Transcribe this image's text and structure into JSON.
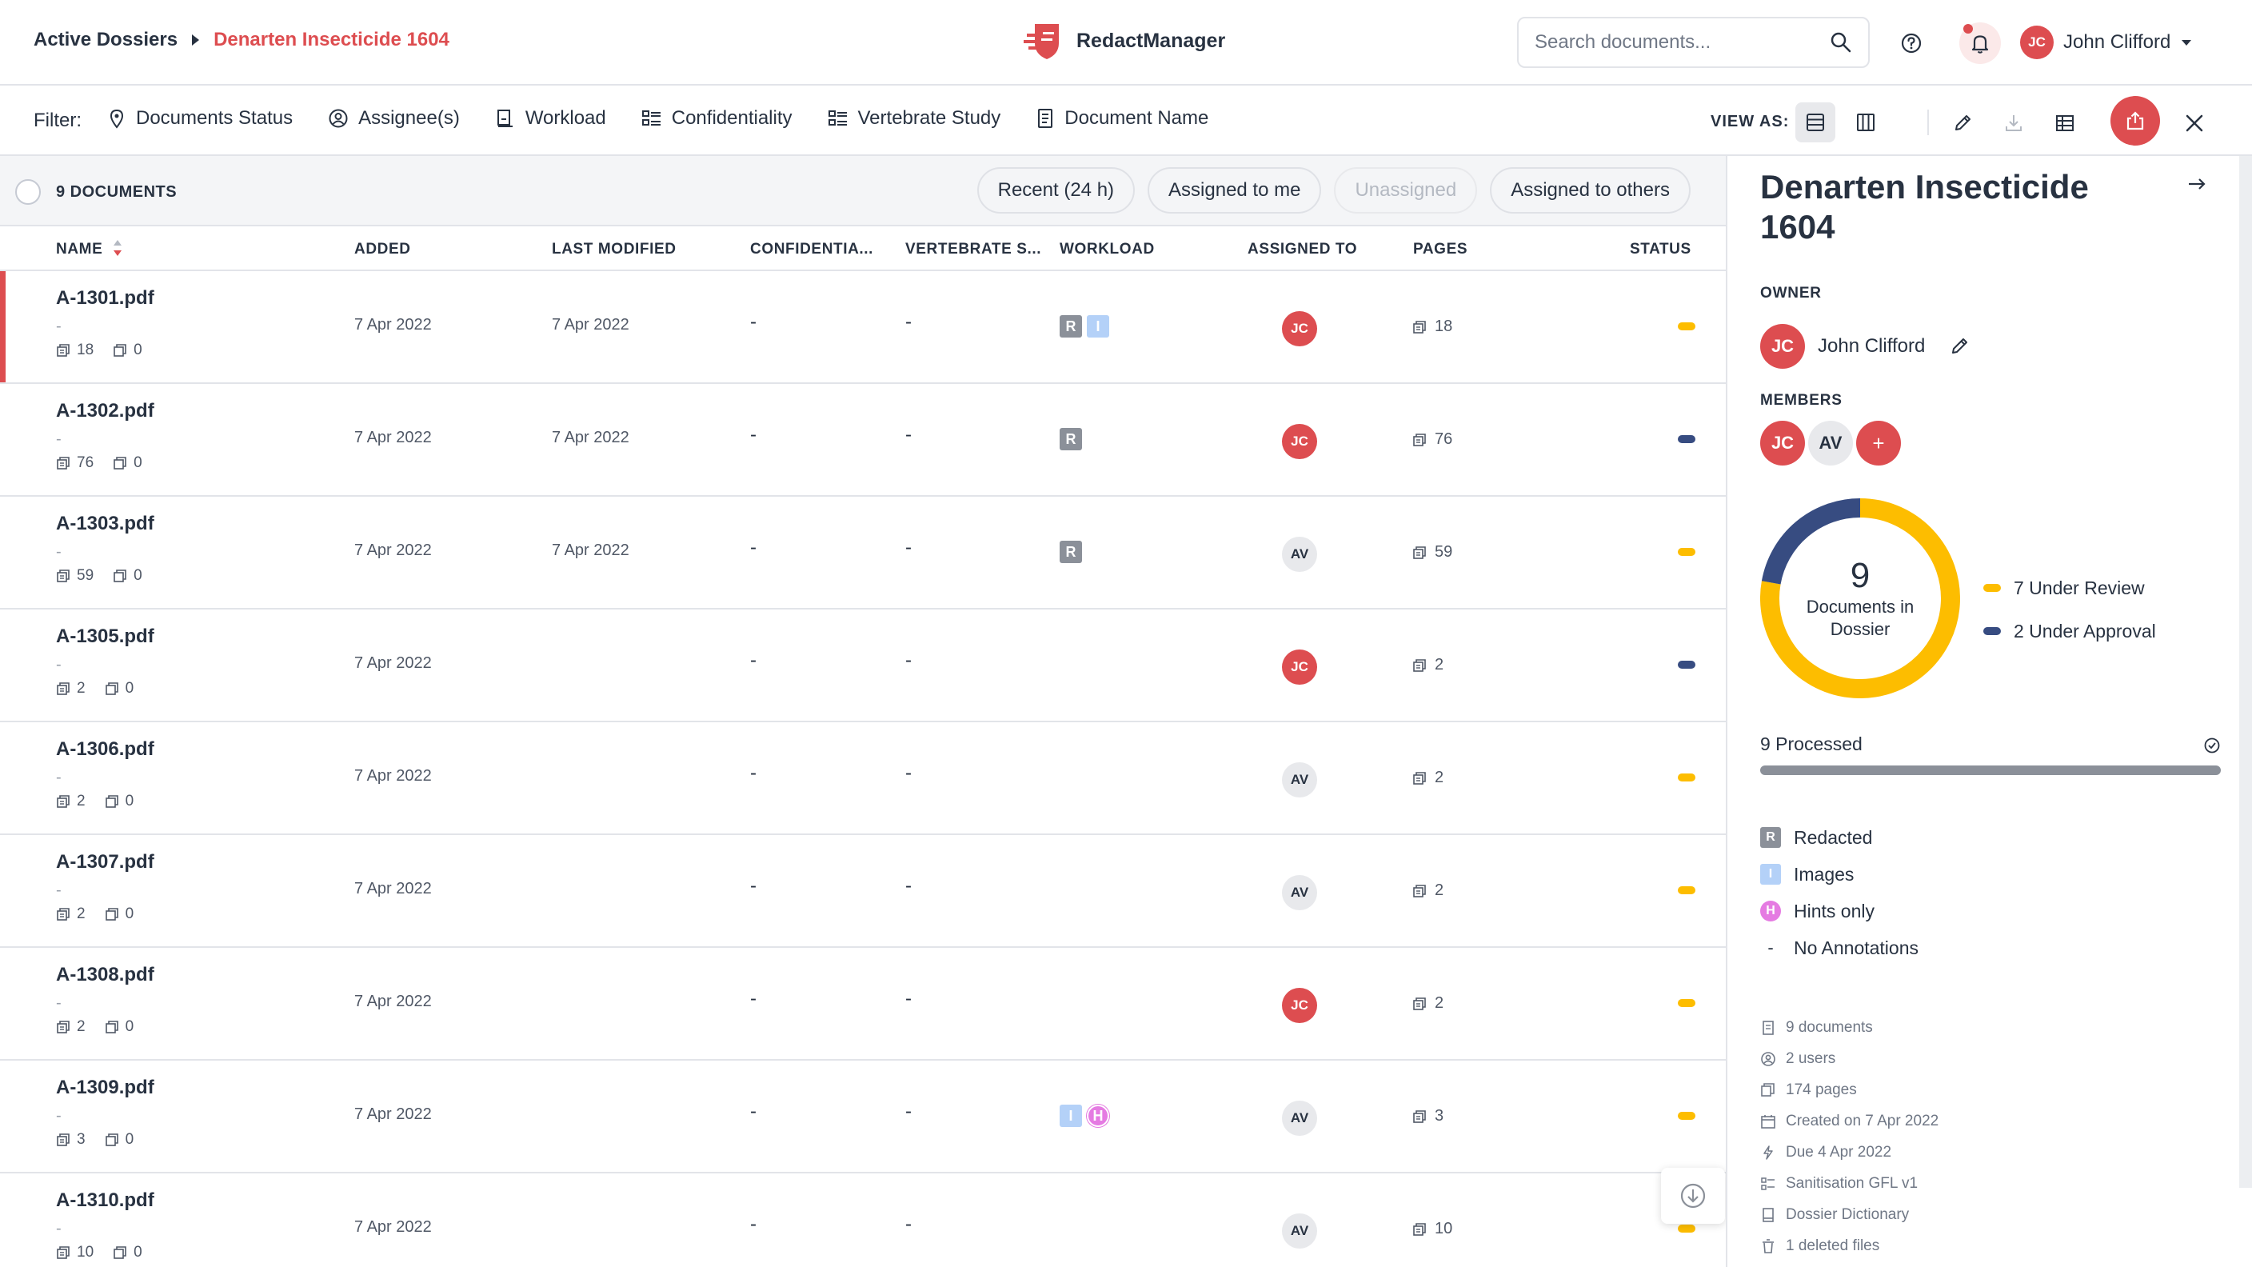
{
  "header": {
    "breadcrumb_root": "Active Dossiers",
    "breadcrumb_current": "Denarten Insecticide 1604",
    "app_name": "RedactManager",
    "search_placeholder": "Search documents...",
    "user_initials": "JC",
    "user_name": "John Clifford"
  },
  "filters": {
    "label": "Filter:",
    "items": [
      {
        "label": "Documents Status",
        "icon": "pin-icon"
      },
      {
        "label": "Assignee(s)",
        "icon": "user-circle-icon"
      },
      {
        "label": "Workload",
        "icon": "workload-icon"
      },
      {
        "label": "Confidentiality",
        "icon": "list-icon"
      },
      {
        "label": "Vertebrate Study",
        "icon": "list-icon"
      },
      {
        "label": "Document Name",
        "icon": "document-icon"
      }
    ],
    "view_as_label": "VIEW AS:"
  },
  "list": {
    "count_label": "9 DOCUMENTS",
    "quick_filters": [
      {
        "label": "Recent (24 h)",
        "disabled": false
      },
      {
        "label": "Assigned to me",
        "disabled": false
      },
      {
        "label": "Unassigned",
        "disabled": true
      },
      {
        "label": "Assigned to others",
        "disabled": false
      }
    ],
    "columns": [
      "NAME",
      "ADDED",
      "LAST MODIFIED",
      "CONFIDENTIA...",
      "VERTEBRATE S...",
      "WORKLOAD",
      "ASSIGNED TO",
      "PAGES",
      "STATUS"
    ],
    "rows": [
      {
        "name": "A-1301.pdf",
        "sub": "-",
        "pages_meta": "18",
        "excluded": "0",
        "added": "7 Apr 2022",
        "modified": "7 Apr 2022",
        "conf": "-",
        "vert": "-",
        "workload": [
          "R",
          "I"
        ],
        "assignee": "JC",
        "pages": "18",
        "status": "under-review",
        "selected": true
      },
      {
        "name": "A-1302.pdf",
        "sub": "-",
        "pages_meta": "76",
        "excluded": "0",
        "added": "7 Apr 2022",
        "modified": "7 Apr 2022",
        "conf": "-",
        "vert": "-",
        "workload": [
          "R"
        ],
        "assignee": "JC",
        "pages": "76",
        "status": "under-approval",
        "selected": false
      },
      {
        "name": "A-1303.pdf",
        "sub": "-",
        "pages_meta": "59",
        "excluded": "0",
        "added": "7 Apr 2022",
        "modified": "7 Apr 2022",
        "conf": "-",
        "vert": "-",
        "workload": [
          "R"
        ],
        "assignee": "AV",
        "pages": "59",
        "status": "under-review",
        "selected": false
      },
      {
        "name": "A-1305.pdf",
        "sub": "-",
        "pages_meta": "2",
        "excluded": "0",
        "added": "7 Apr 2022",
        "modified": "",
        "conf": "-",
        "vert": "-",
        "workload": [],
        "assignee": "JC",
        "pages": "2",
        "status": "under-approval",
        "selected": false
      },
      {
        "name": "A-1306.pdf",
        "sub": "-",
        "pages_meta": "2",
        "excluded": "0",
        "added": "7 Apr 2022",
        "modified": "",
        "conf": "-",
        "vert": "-",
        "workload": [],
        "assignee": "AV",
        "pages": "2",
        "status": "under-review",
        "selected": false
      },
      {
        "name": "A-1307.pdf",
        "sub": "-",
        "pages_meta": "2",
        "excluded": "0",
        "added": "7 Apr 2022",
        "modified": "",
        "conf": "-",
        "vert": "-",
        "workload": [],
        "assignee": "AV",
        "pages": "2",
        "status": "under-review",
        "selected": false
      },
      {
        "name": "A-1308.pdf",
        "sub": "-",
        "pages_meta": "2",
        "excluded": "0",
        "added": "7 Apr 2022",
        "modified": "",
        "conf": "-",
        "vert": "-",
        "workload": [],
        "assignee": "JC",
        "pages": "2",
        "status": "under-review",
        "selected": false
      },
      {
        "name": "A-1309.pdf",
        "sub": "-",
        "pages_meta": "3",
        "excluded": "0",
        "added": "7 Apr 2022",
        "modified": "",
        "conf": "-",
        "vert": "-",
        "workload": [
          "I",
          "H"
        ],
        "assignee": "AV",
        "pages": "3",
        "status": "under-review",
        "selected": false
      },
      {
        "name": "A-1310.pdf",
        "sub": "-",
        "pages_meta": "10",
        "excluded": "0",
        "added": "7 Apr 2022",
        "modified": "",
        "conf": "-",
        "vert": "-",
        "workload": [],
        "assignee": "AV",
        "pages": "10",
        "status": "under-review",
        "selected": false
      }
    ]
  },
  "panel": {
    "title": "Denarten Insecticide 1604",
    "owner_label": "OWNER",
    "owner_initials": "JC",
    "owner_name": "John Clifford",
    "members_label": "MEMBERS",
    "members": [
      "JC",
      "AV"
    ],
    "add_member": "+",
    "donut_total": "9",
    "donut_label": "Documents in Dossier",
    "status_counts": [
      {
        "label": "7 Under Review",
        "value": 7,
        "color": "#fdbd00"
      },
      {
        "label": "2 Under Approval",
        "value": 2,
        "color": "#374c81"
      }
    ],
    "processed_label": "9 Processed",
    "processed_fraction": 1.0,
    "annotations": [
      {
        "symbol": "R",
        "label": "Redacted"
      },
      {
        "symbol": "I",
        "label": "Images"
      },
      {
        "symbol": "H",
        "label": "Hints only"
      },
      {
        "symbol": "-",
        "label": "No Annotations"
      }
    ],
    "stats": [
      {
        "icon": "document-icon",
        "label": "9 documents"
      },
      {
        "icon": "user-circle-icon",
        "label": "2 users"
      },
      {
        "icon": "pages-icon",
        "label": "174 pages"
      },
      {
        "icon": "calendar-icon",
        "label": "Created on 7 Apr 2022"
      },
      {
        "icon": "lightning-icon",
        "label": "Due 4 Apr 2022"
      },
      {
        "icon": "list-icon",
        "label": "Sanitisation GFL v1"
      },
      {
        "icon": "book-icon",
        "label": "Dossier Dictionary"
      },
      {
        "icon": "trash-icon",
        "label": "1 deleted files"
      }
    ]
  },
  "colors": {
    "accent": "#dd4d50",
    "under_review": "#fdbd00",
    "under_approval": "#374c81",
    "text": "#283241"
  }
}
